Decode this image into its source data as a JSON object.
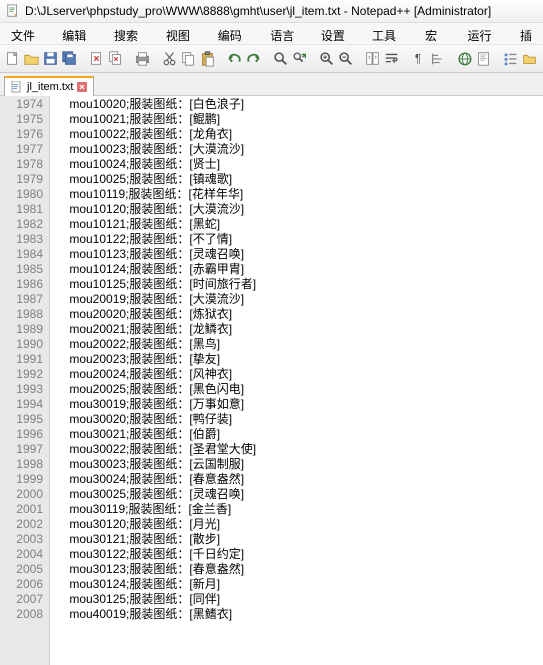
{
  "titlebar": {
    "path": "D:\\JLserver\\phpstudy_pro\\WWW\\8888\\gmht\\user\\jl_item.txt - Notepad++ [Administrator]"
  },
  "menubar": {
    "items": [
      "文件(F)",
      "编辑(E)",
      "搜索(S)",
      "视图(V)",
      "编码(N)",
      "语言(L)",
      "设置(T)",
      "工具(O)",
      "宏(M)",
      "运行(R)",
      "插"
    ]
  },
  "tab": {
    "label": "jl_item.txt"
  },
  "lines": [
    {
      "n": 1974,
      "t": "    mou10020;服装图纸：[白色浪子]"
    },
    {
      "n": 1975,
      "t": "    mou10021;服装图纸：[鲲鹏]"
    },
    {
      "n": 1976,
      "t": "    mou10022;服装图纸：[龙角衣]"
    },
    {
      "n": 1977,
      "t": "    mou10023;服装图纸：[大漠流沙]"
    },
    {
      "n": 1978,
      "t": "    mou10024;服装图纸：[贤士]"
    },
    {
      "n": 1979,
      "t": "    mou10025;服装图纸：[镇魂歌]"
    },
    {
      "n": 1980,
      "t": "    mou10119;服装图纸：[花样年华]"
    },
    {
      "n": 1981,
      "t": "    mou10120;服装图纸：[大漠流沙]"
    },
    {
      "n": 1982,
      "t": "    mou10121;服装图纸：[黑蛇]"
    },
    {
      "n": 1983,
      "t": "    mou10122;服装图纸：[不了情]"
    },
    {
      "n": 1984,
      "t": "    mou10123;服装图纸：[灵魂召唤]"
    },
    {
      "n": 1985,
      "t": "    mou10124;服装图纸：[赤霸甲胄]"
    },
    {
      "n": 1986,
      "t": "    mou10125;服装图纸：[时间旅行者]"
    },
    {
      "n": 1987,
      "t": "    mou20019;服装图纸：[大漠流沙]"
    },
    {
      "n": 1988,
      "t": "    mou20020;服装图纸：[炼狱衣]"
    },
    {
      "n": 1989,
      "t": "    mou20021;服装图纸：[龙鳞衣]"
    },
    {
      "n": 1990,
      "t": "    mou20022;服装图纸：[黑鸟]"
    },
    {
      "n": 1991,
      "t": "    mou20023;服装图纸：[挚友]"
    },
    {
      "n": 1992,
      "t": "    mou20024;服装图纸：[风神衣]"
    },
    {
      "n": 1993,
      "t": "    mou20025;服装图纸：[黑色闪电]"
    },
    {
      "n": 1994,
      "t": "    mou30019;服装图纸：[万事如意]"
    },
    {
      "n": 1995,
      "t": "    mou30020;服装图纸：[鸭仔装]"
    },
    {
      "n": 1996,
      "t": "    mou30021;服装图纸：[伯爵]"
    },
    {
      "n": 1997,
      "t": "    mou30022;服装图纸：[圣君堂大使]"
    },
    {
      "n": 1998,
      "t": "    mou30023;服装图纸：[云国制服]"
    },
    {
      "n": 1999,
      "t": "    mou30024;服装图纸：[春意盎然]"
    },
    {
      "n": 2000,
      "t": "    mou30025;服装图纸：[灵魂召唤]"
    },
    {
      "n": 2001,
      "t": "    mou30119;服装图纸：[金兰香]"
    },
    {
      "n": 2002,
      "t": "    mou30120;服装图纸：[月光]"
    },
    {
      "n": 2003,
      "t": "    mou30121;服装图纸：[散步]"
    },
    {
      "n": 2004,
      "t": "    mou30122;服装图纸：[千日约定]"
    },
    {
      "n": 2005,
      "t": "    mou30123;服装图纸：[春意盎然]"
    },
    {
      "n": 2006,
      "t": "    mou30124;服装图纸：[新月]"
    },
    {
      "n": 2007,
      "t": "    mou30125;服装图纸：[同伴]"
    },
    {
      "n": 2008,
      "t": "    mou40019;服装图纸：[黑鳍衣]"
    }
  ],
  "toolbar_icons": [
    "new-file-icon",
    "open-file-icon",
    "save-icon",
    "save-all-icon",
    "sep",
    "close-icon",
    "close-all-icon",
    "sep",
    "print-icon",
    "sep",
    "cut-icon",
    "copy-icon",
    "paste-icon",
    "sep",
    "undo-icon",
    "redo-icon",
    "sep",
    "find-icon",
    "replace-icon",
    "sep",
    "zoom-in-icon",
    "zoom-out-icon",
    "sep",
    "sync-scroll-icon",
    "word-wrap-icon",
    "sep",
    "show-all-chars-icon",
    "indent-guide-icon",
    "sep",
    "language-icon",
    "doc-map-icon",
    "sep",
    "func-list-icon",
    "folder-icon",
    "sep",
    "monitor-icon",
    "record-icon",
    "play-icon"
  ]
}
